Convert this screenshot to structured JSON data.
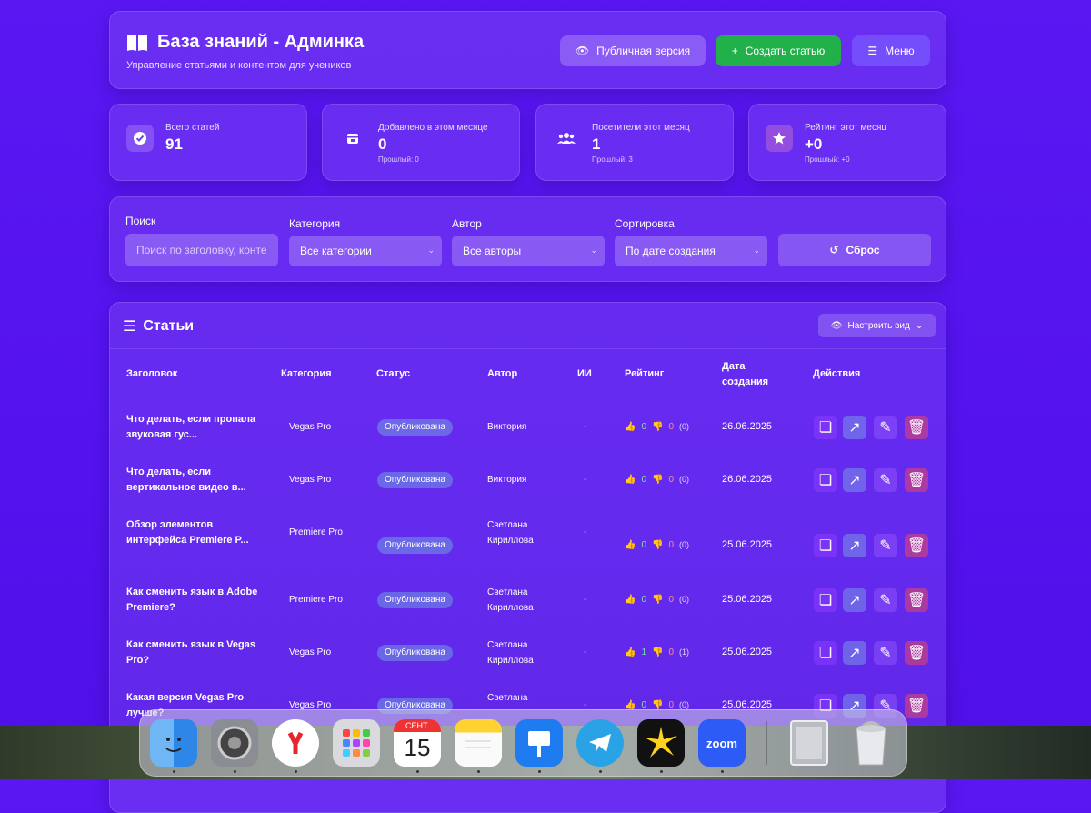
{
  "header": {
    "title": "База знаний - Админка",
    "subtitle": "Управление статьями и контентом для учеников",
    "public_label": "Публичная версия",
    "create_label": "Создать статью",
    "menu_label": "Меню"
  },
  "stats": [
    {
      "label": "Всего статей",
      "value": "91",
      "prev": "",
      "icon": "check-circle-icon"
    },
    {
      "label": "Добавлено в этом месяце",
      "value": "0",
      "prev": "Прошлый: 0",
      "icon": "calendar-icon"
    },
    {
      "label": "Посетители этот месяц",
      "value": "1",
      "prev": "Прошлый: 3",
      "icon": "users-icon"
    },
    {
      "label": "Рейтинг этот месяц",
      "value": "+0",
      "prev": "Прошлый: +0",
      "icon": "star-icon"
    }
  ],
  "filters": {
    "search_label": "Поиск",
    "search_placeholder": "Поиск по заголовку, конте",
    "category_label": "Категория",
    "category_value": "Все категории",
    "author_label": "Автор",
    "author_value": "Все авторы",
    "sort_label": "Сортировка",
    "sort_value": "По дате создания",
    "reset_label": "Сброс"
  },
  "table": {
    "title": "Статьи",
    "view_label": "Настроить вид",
    "columns": {
      "title": "Заголовок",
      "category": "Категория",
      "status": "Статус",
      "author": "Автор",
      "ai": "ИИ",
      "rating": "Рейтинг",
      "date1": "Дата",
      "date2": "создания",
      "actions": "Действия"
    },
    "rows": [
      {
        "title": "Что делать, если пропала звуковая гус...",
        "category": "Vegas Pro",
        "status": "Опубликована",
        "author": "Виктория",
        "ai": "-",
        "up": "0",
        "down": "0",
        "count": "(0)",
        "date": "26.06.2025"
      },
      {
        "title": "Что делать, если вертикальное видео в...",
        "category": "Vegas Pro",
        "status": "Опубликована",
        "author": "Виктория",
        "ai": "-",
        "up": "0",
        "down": "0",
        "count": "(0)",
        "date": "26.06.2025"
      },
      {
        "title": "Обзор элементов интерфейса Premiere P...",
        "category": "Premiere Pro",
        "status": "Опубликована",
        "author": "Светлана Кириллова",
        "ai": "-",
        "up": "0",
        "down": "0",
        "count": "(0)",
        "date": "25.06.2025"
      },
      {
        "title": "Как сменить язык в Adobe Premiere?",
        "category": "Premiere Pro",
        "status": "Опубликована",
        "author": "Светлана Кириллова",
        "ai": "-",
        "up": "0",
        "down": "0",
        "count": "(0)",
        "date": "25.06.2025"
      },
      {
        "title": "Как сменить язык в Vegas Pro?",
        "category": "Vegas Pro",
        "status": "Опубликована",
        "author": "Светлана Кириллова",
        "ai": "-",
        "up": "1",
        "down": "0",
        "count": "(1)",
        "date": "25.06.2025"
      },
      {
        "title": "Какая версия Vegas Pro лучше?",
        "category": "Vegas Pro",
        "status": "Опубликована",
        "author": "Светлана",
        "ai": "-",
        "up": "0",
        "down": "0",
        "count": "(0)",
        "date": "25.06.2025"
      }
    ]
  },
  "dock": {
    "calendar_month": "СЕНТ.",
    "calendar_day": "15",
    "zoom_label": "zoom",
    "apps": [
      "finder-icon",
      "system-settings-icon",
      "yandex-browser-icon",
      "launchpad-icon",
      "calendar-icon",
      "notes-icon",
      "keynote-icon",
      "telegram-icon",
      "sunburst-app-icon",
      "zoom-icon",
      "folder-stack-icon",
      "trash-icon"
    ]
  },
  "colors": {
    "background": "#5513ef",
    "create_button": "#22b04a",
    "delete_action": "#dc466e"
  }
}
